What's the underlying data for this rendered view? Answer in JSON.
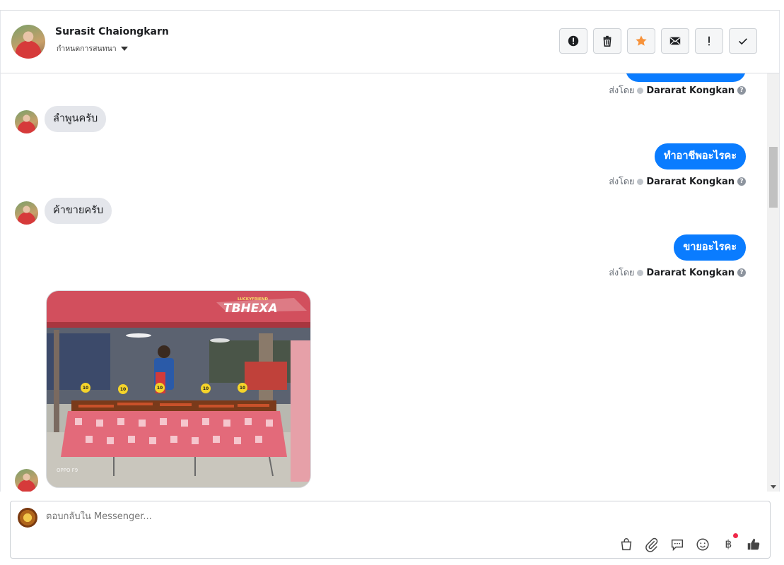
{
  "header": {
    "contact_name": "Surasit Chaiongkarn",
    "conversation_label": "กำหนดการสนทนา",
    "toolbar": [
      {
        "name": "report-button",
        "icon": "alert-circle-icon"
      },
      {
        "name": "delete-button",
        "icon": "trash-icon"
      },
      {
        "name": "star-button",
        "icon": "star-icon"
      },
      {
        "name": "mark-unread-button",
        "icon": "envelope-icon"
      },
      {
        "name": "mark-important-button",
        "icon": "exclamation-icon"
      },
      {
        "name": "mark-done-button",
        "icon": "check-icon"
      }
    ]
  },
  "thread": {
    "sent_by_label": "ส่งโดย",
    "agent_name": "Dararat Kongkan",
    "messages": [
      {
        "direction": "out",
        "text": ""
      },
      {
        "direction": "in",
        "text": "ลำพูนครับ"
      },
      {
        "direction": "out",
        "text": "ทำอาชีพอะไรคะ"
      },
      {
        "direction": "in",
        "text": "ค้าขายครับ"
      },
      {
        "direction": "out",
        "text": "ขายอะไรคะ"
      },
      {
        "direction": "in",
        "type": "photo",
        "text": ""
      }
    ],
    "photo": {
      "banner_text": "TBHEXA",
      "banner_small": "LUCKYFRIEND",
      "watermark": "OPPO F9",
      "price_tags": [
        "10",
        "10",
        "10",
        "10",
        "10"
      ]
    }
  },
  "composer": {
    "placeholder": "ตอบกลับใน Messenger...",
    "actions": [
      "shop-bag-icon",
      "paperclip-icon",
      "saved-reply-icon",
      "emoji-icon",
      "baht-payment-icon",
      "like-thumb-icon"
    ]
  },
  "colors": {
    "outgoing_bubble": "#0a7cff",
    "incoming_bubble": "#e4e6eb",
    "star": "#f7923a",
    "notification_dot": "#f02849"
  }
}
